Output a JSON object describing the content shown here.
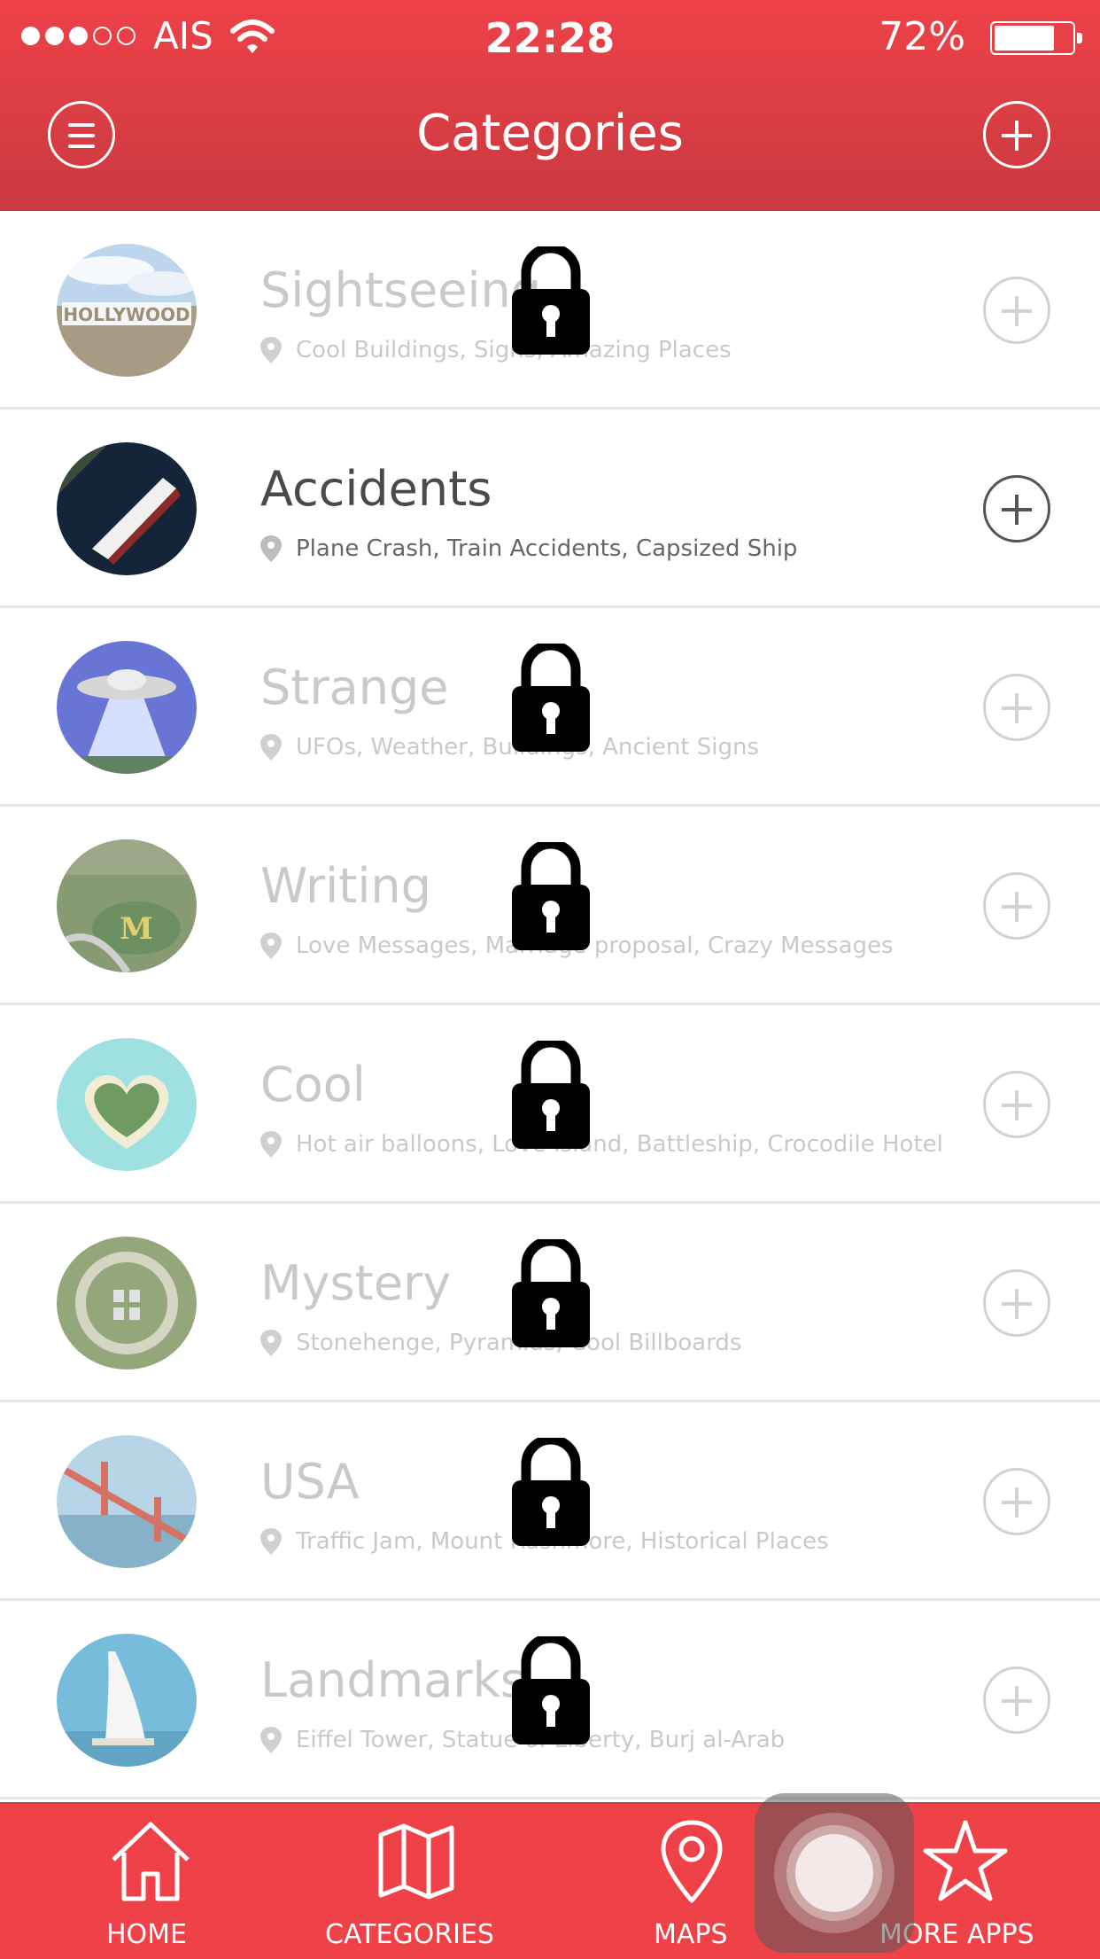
{
  "status_bar": {
    "carrier": "AIS",
    "signal_bars_filled": 3,
    "signal_bars_total": 5,
    "time": "22:28",
    "battery": "72%",
    "battery_level": 0.72
  },
  "header": {
    "title": "Categories",
    "menu_icon": "hamburger-menu-icon",
    "add_icon": "plus-circle-icon",
    "background": "#ef4148"
  },
  "categories": [
    {
      "name": "Sightseeing",
      "subtitle": "Cool Buildings, Signs, Amazing Places",
      "locked": true,
      "thumb": "hollywood-sign"
    },
    {
      "name": "Accidents",
      "subtitle": "Plane Crash, Train Accidents, Capsized Ship",
      "locked": false,
      "thumb": "capsized-ship"
    },
    {
      "name": "Strange",
      "subtitle": "UFOs, Weather, Buildings, Ancient Signs",
      "locked": true,
      "thumb": "ufo"
    },
    {
      "name": "Writing",
      "subtitle": "Love Messages, Marriage proposal, Crazy Messages",
      "locked": true,
      "thumb": "field-letter-m"
    },
    {
      "name": "Cool",
      "subtitle": "Hot air balloons, Love Island, Battleship, Crocodile Hotel",
      "locked": true,
      "thumb": "heart-island"
    },
    {
      "name": "Mystery",
      "subtitle": "Stonehenge, Pyramids, Cool Billboards",
      "locked": true,
      "thumb": "stonehenge"
    },
    {
      "name": "USA",
      "subtitle": "Traffic Jam, Mount Rushmore, Historical Places",
      "locked": true,
      "thumb": "golden-gate-bridge"
    },
    {
      "name": "Landmarks",
      "subtitle": "Eiffel Tower, Statue of Liberty, Burj al-Arab",
      "locked": true,
      "thumb": "burj-al-arab"
    }
  ],
  "tabs": [
    {
      "label": "HOME",
      "icon": "home-icon"
    },
    {
      "label": "CATEGORIES",
      "icon": "map-icon"
    },
    {
      "label": "MAPS",
      "icon": "location-pin-icon"
    },
    {
      "label": "MORE APPS",
      "icon": "star-icon"
    }
  ],
  "colors": {
    "accent": "#ef4148",
    "locked_text": "#c9c9c9",
    "text": "#4a4a4a"
  }
}
